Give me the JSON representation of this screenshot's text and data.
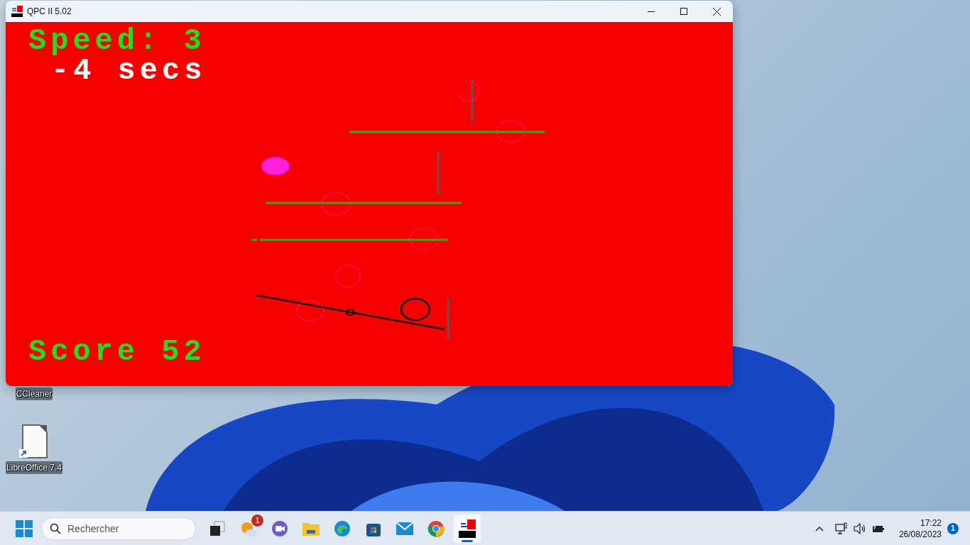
{
  "window": {
    "title": "QPC II 5.02"
  },
  "game": {
    "speed_label": "Speed: 3",
    "timer": "-4 secs",
    "score": "Score 52"
  },
  "desktop_icons": [
    {
      "kind": "hidden",
      "label": "CCleaner"
    },
    {
      "kind": "document",
      "label": "LibreOffice 7.4"
    }
  ],
  "taskbar": {
    "search": {
      "placeholder": "Rechercher"
    },
    "apps": [
      {
        "kind": "taskview",
        "active": false
      },
      {
        "kind": "weather",
        "active": false,
        "badge": "1"
      },
      {
        "kind": "meet",
        "active": false
      },
      {
        "kind": "folder",
        "active": false
      },
      {
        "kind": "edge",
        "active": false
      },
      {
        "kind": "store",
        "active": false
      },
      {
        "kind": "mail",
        "active": false
      },
      {
        "kind": "chrome",
        "active": false
      },
      {
        "kind": "qpc",
        "active": true
      }
    ]
  },
  "tray": {
    "time": "17:22",
    "date": "26/08/2023",
    "notifications": "1"
  }
}
